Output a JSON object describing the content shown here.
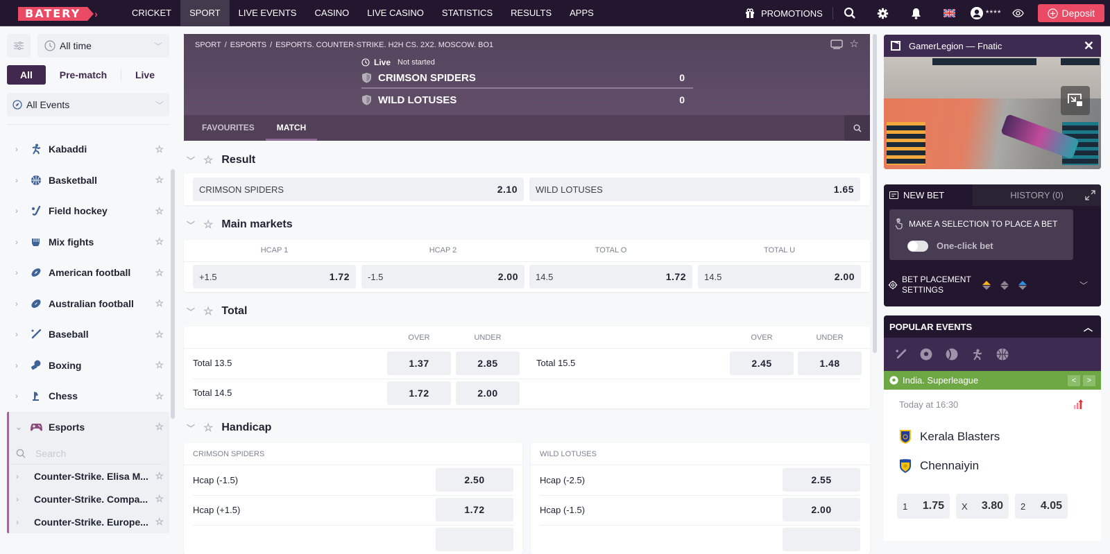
{
  "nav": {
    "logo": "BATERY",
    "items": [
      "CRICKET",
      "SPORT",
      "LIVE EVENTS",
      "CASINO",
      "LIVE CASINO",
      "STATISTICS",
      "RESULTS",
      "APPS"
    ],
    "active": "SPORT",
    "promotions": "PROMOTIONS",
    "user_masked": "****",
    "deposit": "Deposit"
  },
  "sidebar": {
    "time_filter": "All time",
    "segments": [
      "All",
      "Pre-match",
      "Live"
    ],
    "active_segment": "All",
    "events_filter": "All Events",
    "sports": [
      {
        "label": "Kabaddi",
        "icon": "kabaddi-icon"
      },
      {
        "label": "Basketball",
        "icon": "basketball-icon"
      },
      {
        "label": "Field hockey",
        "icon": "field-hockey-icon"
      },
      {
        "label": "Mix fights",
        "icon": "mma-glove-icon"
      },
      {
        "label": "American football",
        "icon": "american-football-icon"
      },
      {
        "label": "Australian football",
        "icon": "australian-football-icon"
      },
      {
        "label": "Baseball",
        "icon": "baseball-bat-icon"
      },
      {
        "label": "Boxing",
        "icon": "boxing-glove-icon"
      },
      {
        "label": "Chess",
        "icon": "chess-knight-icon"
      }
    ],
    "expanded": {
      "label": "Esports",
      "icon": "gamepad-icon",
      "search_placeholder": "Search",
      "leagues": [
        "Counter-Strike. Elisa M...",
        "Counter-Strike. Compa...",
        "Counter-Strike. Europe..."
      ]
    }
  },
  "match": {
    "breadcrumb": [
      "SPORT",
      "ESPORTS",
      "ESPORTS. COUNTER-STRIKE. H2H CS. 2X2. MOSCOW. BO1"
    ],
    "status_live": "Live",
    "status_text": "Not started",
    "team1": {
      "name": "CRIMSON SPIDERS",
      "score": "0"
    },
    "team2": {
      "name": "WILD LOTUSES",
      "score": "0"
    },
    "tabs": [
      "FAVOURITES",
      "MATCH"
    ],
    "active_tab": "MATCH"
  },
  "markets": {
    "result": {
      "title": "Result",
      "odds": [
        {
          "label": "CRIMSON SPIDERS",
          "value": "2.10"
        },
        {
          "label": "WILD LOTUSES",
          "value": "1.65"
        }
      ]
    },
    "main": {
      "title": "Main markets",
      "columns": [
        "HCAP 1",
        "HCAP 2",
        "TOTAL O",
        "TOTAL U"
      ],
      "odds": [
        {
          "label": "+1.5",
          "value": "1.72"
        },
        {
          "label": "-1.5",
          "value": "2.00"
        },
        {
          "label": "14.5",
          "value": "1.72"
        },
        {
          "label": "14.5",
          "value": "2.00"
        }
      ]
    },
    "total": {
      "title": "Total",
      "over": "OVER",
      "under": "UNDER",
      "left": [
        {
          "label": "Total 13.5",
          "over": "1.37",
          "under": "2.85"
        },
        {
          "label": "Total 14.5",
          "over": "1.72",
          "under": "2.00"
        }
      ],
      "right": [
        {
          "label": "Total 15.5",
          "over": "2.45",
          "under": "1.48"
        }
      ]
    },
    "handicap": {
      "title": "Handicap",
      "left": {
        "team": "CRIMSON SPIDERS",
        "rows": [
          {
            "label": "Hcap (-1.5)",
            "value": "2.50"
          },
          {
            "label": "Hcap (+1.5)",
            "value": "1.72"
          }
        ]
      },
      "right": {
        "team": "WILD LOTUSES",
        "rows": [
          {
            "label": "Hcap (-2.5)",
            "value": "2.55"
          },
          {
            "label": "Hcap (-1.5)",
            "value": "2.00"
          }
        ]
      }
    }
  },
  "stream": {
    "title": "GamerLegion — Fnatic"
  },
  "betslip": {
    "new_bet": "NEW BET",
    "history": "HISTORY (0)",
    "make_selection": "MAKE A SELECTION TO PLACE A BET",
    "one_click": "One-click bet",
    "one_click_enabled": false,
    "settings_label": "BET PLACEMENT SETTINGS",
    "arrow_colors": [
      "#f5b21a",
      "#8d8594",
      "#2f8fe0"
    ]
  },
  "popular": {
    "title": "POPULAR EVENTS",
    "sports_icons": [
      "cricket-icon",
      "football-icon",
      "tennis-icon",
      "kabaddi-icon",
      "basketball-icon"
    ],
    "league": "India. Superleague",
    "event": {
      "time": "Today at 16:30",
      "team1": "Kerala Blasters",
      "team2": "Chennaiyin",
      "odds": [
        {
          "label": "1",
          "value": "1.75"
        },
        {
          "label": "X",
          "value": "3.80"
        },
        {
          "label": "2",
          "value": "4.05"
        }
      ]
    }
  },
  "colors": {
    "brand": "#ea4a64",
    "nav_bg": "#22172f",
    "accent": "#40284f",
    "league_green": "#6da845"
  }
}
